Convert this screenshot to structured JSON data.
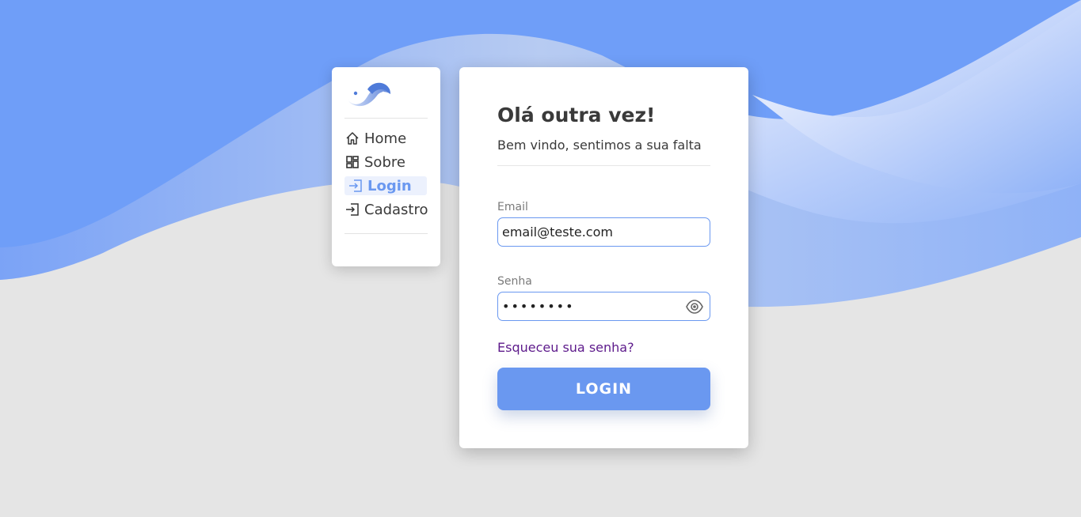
{
  "nav": {
    "items": [
      {
        "label": "Home",
        "icon": "home-icon",
        "active": false
      },
      {
        "label": "Sobre",
        "icon": "grid-icon",
        "active": false
      },
      {
        "label": "Login",
        "icon": "login-icon",
        "active": true
      },
      {
        "label": "Cadastro",
        "icon": "login-icon",
        "active": false
      }
    ]
  },
  "login": {
    "title": "Olá outra vez!",
    "subtitle": "Bem vindo, sentimos a sua falta",
    "email_label": "Email",
    "email_value": "email@teste.com",
    "password_label": "Senha",
    "password_value": "12345678",
    "forgot_link": "Esqueceu sua senha?",
    "button_label": "LOGIN"
  },
  "colors": {
    "accent": "#6a98f0",
    "link": "#5d1a8b",
    "background": "#e5e5e5",
    "wave": "#6f9ef8"
  }
}
